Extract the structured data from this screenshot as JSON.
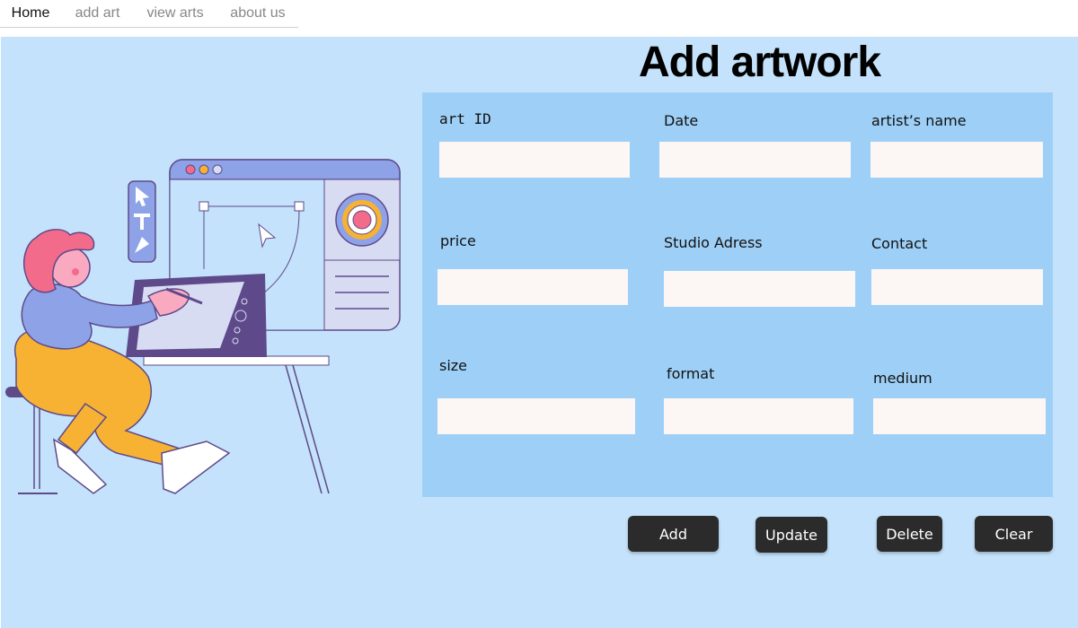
{
  "nav": {
    "items": [
      {
        "label": "Home"
      },
      {
        "label": "add art"
      },
      {
        "label": "view arts"
      },
      {
        "label": "about us"
      }
    ]
  },
  "page": {
    "title": "Add artwork"
  },
  "form": {
    "fields": [
      {
        "label": "art ID",
        "value": ""
      },
      {
        "label": "Date",
        "value": ""
      },
      {
        "label": "artist’s name",
        "value": ""
      },
      {
        "label": "price",
        "value": ""
      },
      {
        "label": "Studio Adress",
        "value": ""
      },
      {
        "label": "Contact",
        "value": ""
      },
      {
        "label": "size",
        "value": ""
      },
      {
        "label": "format",
        "value": ""
      },
      {
        "label": "medium",
        "value": ""
      }
    ]
  },
  "actions": {
    "add": "Add",
    "update": "Update",
    "delete": "Delete",
    "clear": "Clear"
  },
  "colors": {
    "background": "#c4e2fb",
    "panel": "#9ed0f7",
    "input": "#fcf6f5",
    "button": "#2b2b2b",
    "accent_purple": "#5e4a8a",
    "accent_pink": "#f26b8a",
    "accent_yellow": "#f7b234"
  }
}
